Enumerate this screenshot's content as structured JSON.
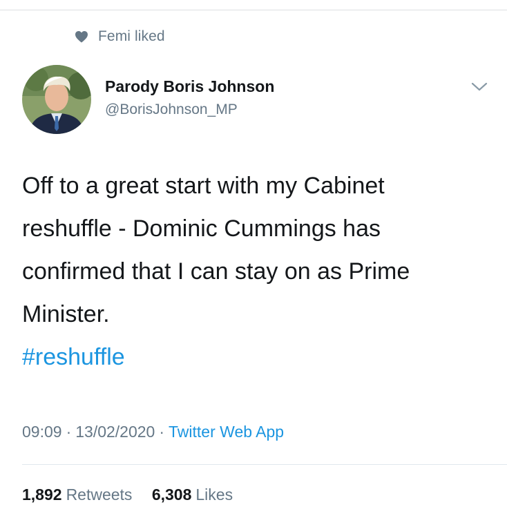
{
  "social_context": {
    "icon": "heart-icon",
    "text": "Femi liked"
  },
  "author": {
    "display_name": "Parody Boris Johnson",
    "handle": "@BorisJohnson_MP",
    "avatar_icon": "avatar-photo"
  },
  "menu": {
    "icon": "chevron-down-icon"
  },
  "tweet": {
    "lines": [
      "Off to a great start with my Cabinet",
      "reshuffle - Dominic Cummings has",
      "confirmed that I can stay on as Prime",
      "Minister."
    ],
    "hashtag": "#reshuffle"
  },
  "meta": {
    "time": "09:09",
    "separator": "·",
    "date": "13/02/2020",
    "source": "Twitter Web App"
  },
  "stats": {
    "retweets_count": "1,892",
    "retweets_label": "Retweets",
    "likes_count": "6,308",
    "likes_label": "Likes"
  },
  "colors": {
    "link": "#1b95e0",
    "secondary_text": "#657786",
    "primary_text": "#14171a",
    "divider": "#e1e8ed"
  }
}
